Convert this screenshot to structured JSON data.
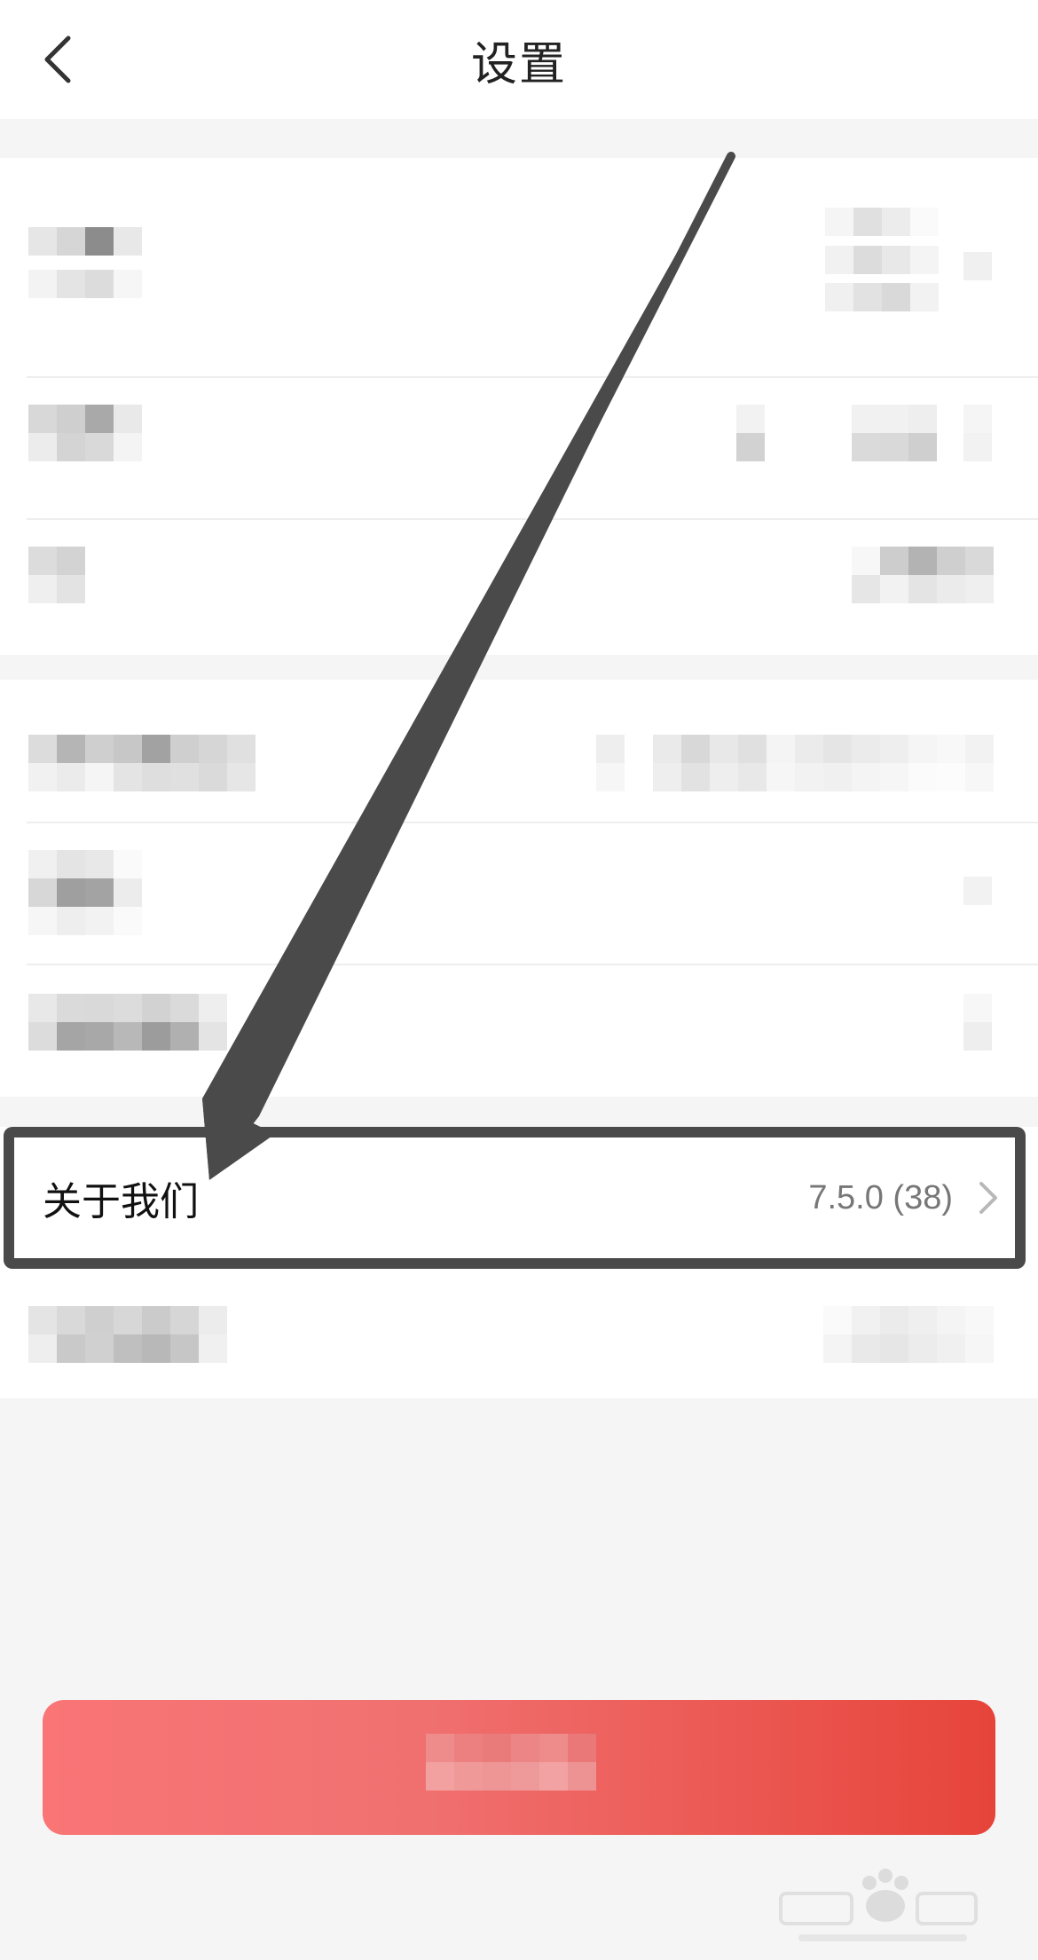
{
  "header": {
    "title": "设置",
    "back_icon": "chevron-left-icon"
  },
  "about": {
    "label": "关于我们",
    "version": "7.5.0 (38)",
    "chevron_icon": "chevron-right-icon"
  },
  "colors": {
    "button_gradient_start": "#f97576",
    "button_gradient_end": "#e6443a",
    "highlight_border": "#4a4a4a",
    "arrow": "#4a4a4a"
  },
  "watermark": {
    "logo": "baidu-jingyan-logo"
  }
}
